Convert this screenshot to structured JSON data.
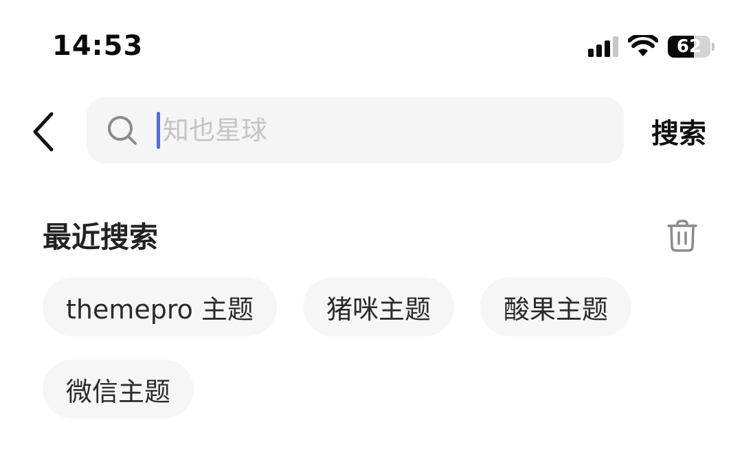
{
  "status_bar": {
    "time": "14:53",
    "signal_bars_active": 3,
    "signal_bars_total": 4,
    "wifi_icon": "wifi-icon",
    "battery_percent": "62",
    "battery_level": 0.62
  },
  "header": {
    "back_icon": "chevron-left-icon",
    "search_icon": "search-icon",
    "search_placeholder": "知也星球",
    "search_value": "",
    "search_button_label": "搜索"
  },
  "recent": {
    "title": "最近搜索",
    "clear_icon": "trash-icon",
    "items": [
      {
        "label": "themepro 主题"
      },
      {
        "label": "猪咪主题"
      },
      {
        "label": "酸果主题"
      },
      {
        "label": "微信主题"
      }
    ]
  },
  "colors": {
    "caret": "#4a6cf7",
    "search_bg": "#f5f5f5",
    "tag_bg": "#f6f6f6",
    "placeholder": "#c4c4c4"
  }
}
